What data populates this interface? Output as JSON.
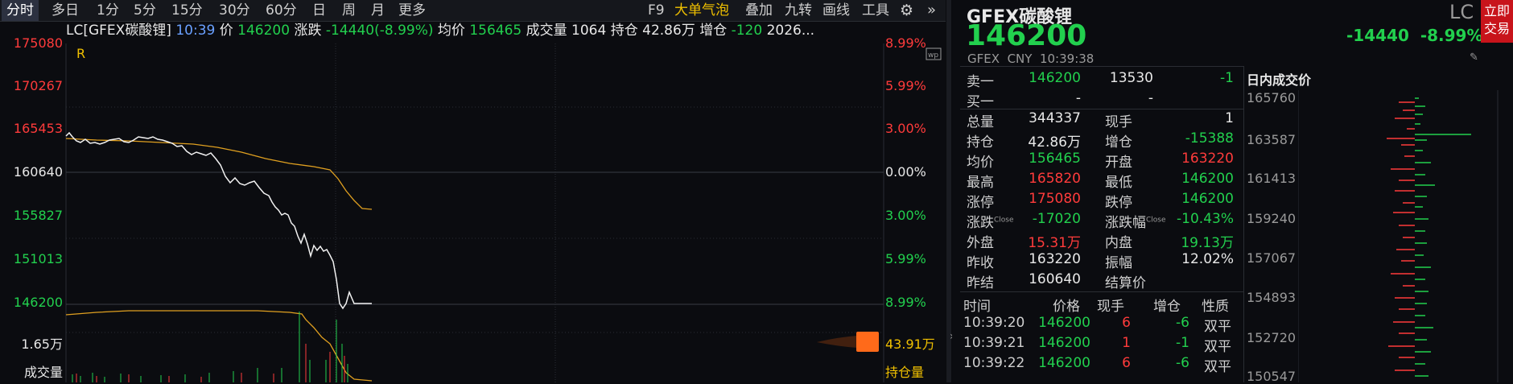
{
  "toolbar": {
    "tabs": [
      "分时",
      "多日",
      "1分",
      "5分",
      "15分",
      "30分",
      "60分",
      "日",
      "周",
      "月",
      "更多"
    ],
    "right": [
      "F9",
      "大单气泡",
      "叠加",
      "九转",
      "画线",
      "工具"
    ]
  },
  "info_line": {
    "code": "LC[GFEX碳酸锂]",
    "time": "10:39",
    "price_label": "价",
    "price": "146200",
    "change_label": "涨跌",
    "change": "-14440(-8.99%)",
    "avg_label": "均价",
    "avg": "156465",
    "volume_label": "成交量",
    "volume": "1064",
    "oi_label": "持仓",
    "oi": "42.86万",
    "oi_chg_label": "增仓",
    "oi_chg": "-120",
    "date": "2026..."
  },
  "r_mark": "R",
  "left_axis": [
    "175080",
    "170267",
    "165453",
    "160640",
    "155827",
    "151013",
    "146200"
  ],
  "right_axis": [
    "8.99%",
    "5.99%",
    "3.00%",
    "0.00%",
    "3.00%",
    "5.99%",
    "8.99%"
  ],
  "vol_axis_left": "1.65万",
  "vol_label_left": "成交量",
  "vol_axis_right": "43.91万",
  "vol_label_right": "持仓量",
  "panel": {
    "name": "GFEX碳酸锂",
    "code": "LC",
    "price": "146200",
    "change": "-14440",
    "change_pct": "-8.99%",
    "exchange": "GFEX",
    "currency": "CNY",
    "time": "10:39:38",
    "trade_btn": [
      "立即",
      "交易"
    ],
    "sell1": {
      "label": "卖一",
      "price": "146200",
      "qty": "13530",
      "chg": "-1"
    },
    "buy1": {
      "label": "买一",
      "price": "-",
      "qty": "-"
    },
    "stats": [
      {
        "l1": "总量",
        "v1": "344337",
        "l2": "现手",
        "v2": "1"
      },
      {
        "l1": "持仓",
        "v1": "42.86万",
        "l2": "增仓",
        "v2": "-15388"
      },
      {
        "l1": "均价",
        "v1": "156465",
        "l2": "开盘",
        "v2": "163220"
      },
      {
        "l1": "最高",
        "v1": "165820",
        "l2": "最低",
        "v2": "146200"
      },
      {
        "l1": "涨停",
        "v1": "175080",
        "l2": "跌停",
        "v2": "146200"
      },
      {
        "l1": "涨跌",
        "v1": "-17020",
        "l2": "涨跌幅",
        "v2": "-10.43%"
      },
      {
        "l1": "外盘",
        "v1": "15.31万",
        "l2": "内盘",
        "v2": "19.13万"
      },
      {
        "l1": "昨收",
        "v1": "163220",
        "l2": "振幅",
        "v2": "12.02%"
      },
      {
        "l1": "昨结",
        "v1": "160640",
        "l2": "结算价",
        "v2": ""
      }
    ],
    "close_tag": "Close",
    "trades_header": [
      "时间",
      "价格",
      "现手",
      "增仓",
      "性质"
    ],
    "trades": [
      {
        "time": "10:39:20",
        "price": "146200",
        "qty": "6",
        "chg": "-6",
        "type": "双平"
      },
      {
        "time": "10:39:21",
        "price": "146200",
        "qty": "1",
        "chg": "-1",
        "type": "双平"
      },
      {
        "time": "10:39:22",
        "price": "146200",
        "qty": "6",
        "chg": "-6",
        "type": "双平"
      }
    ],
    "profile_title": "日内成交价",
    "profile_axis": [
      "165760",
      "163587",
      "161413",
      "159240",
      "157067",
      "154893",
      "152720",
      "150547"
    ]
  }
}
